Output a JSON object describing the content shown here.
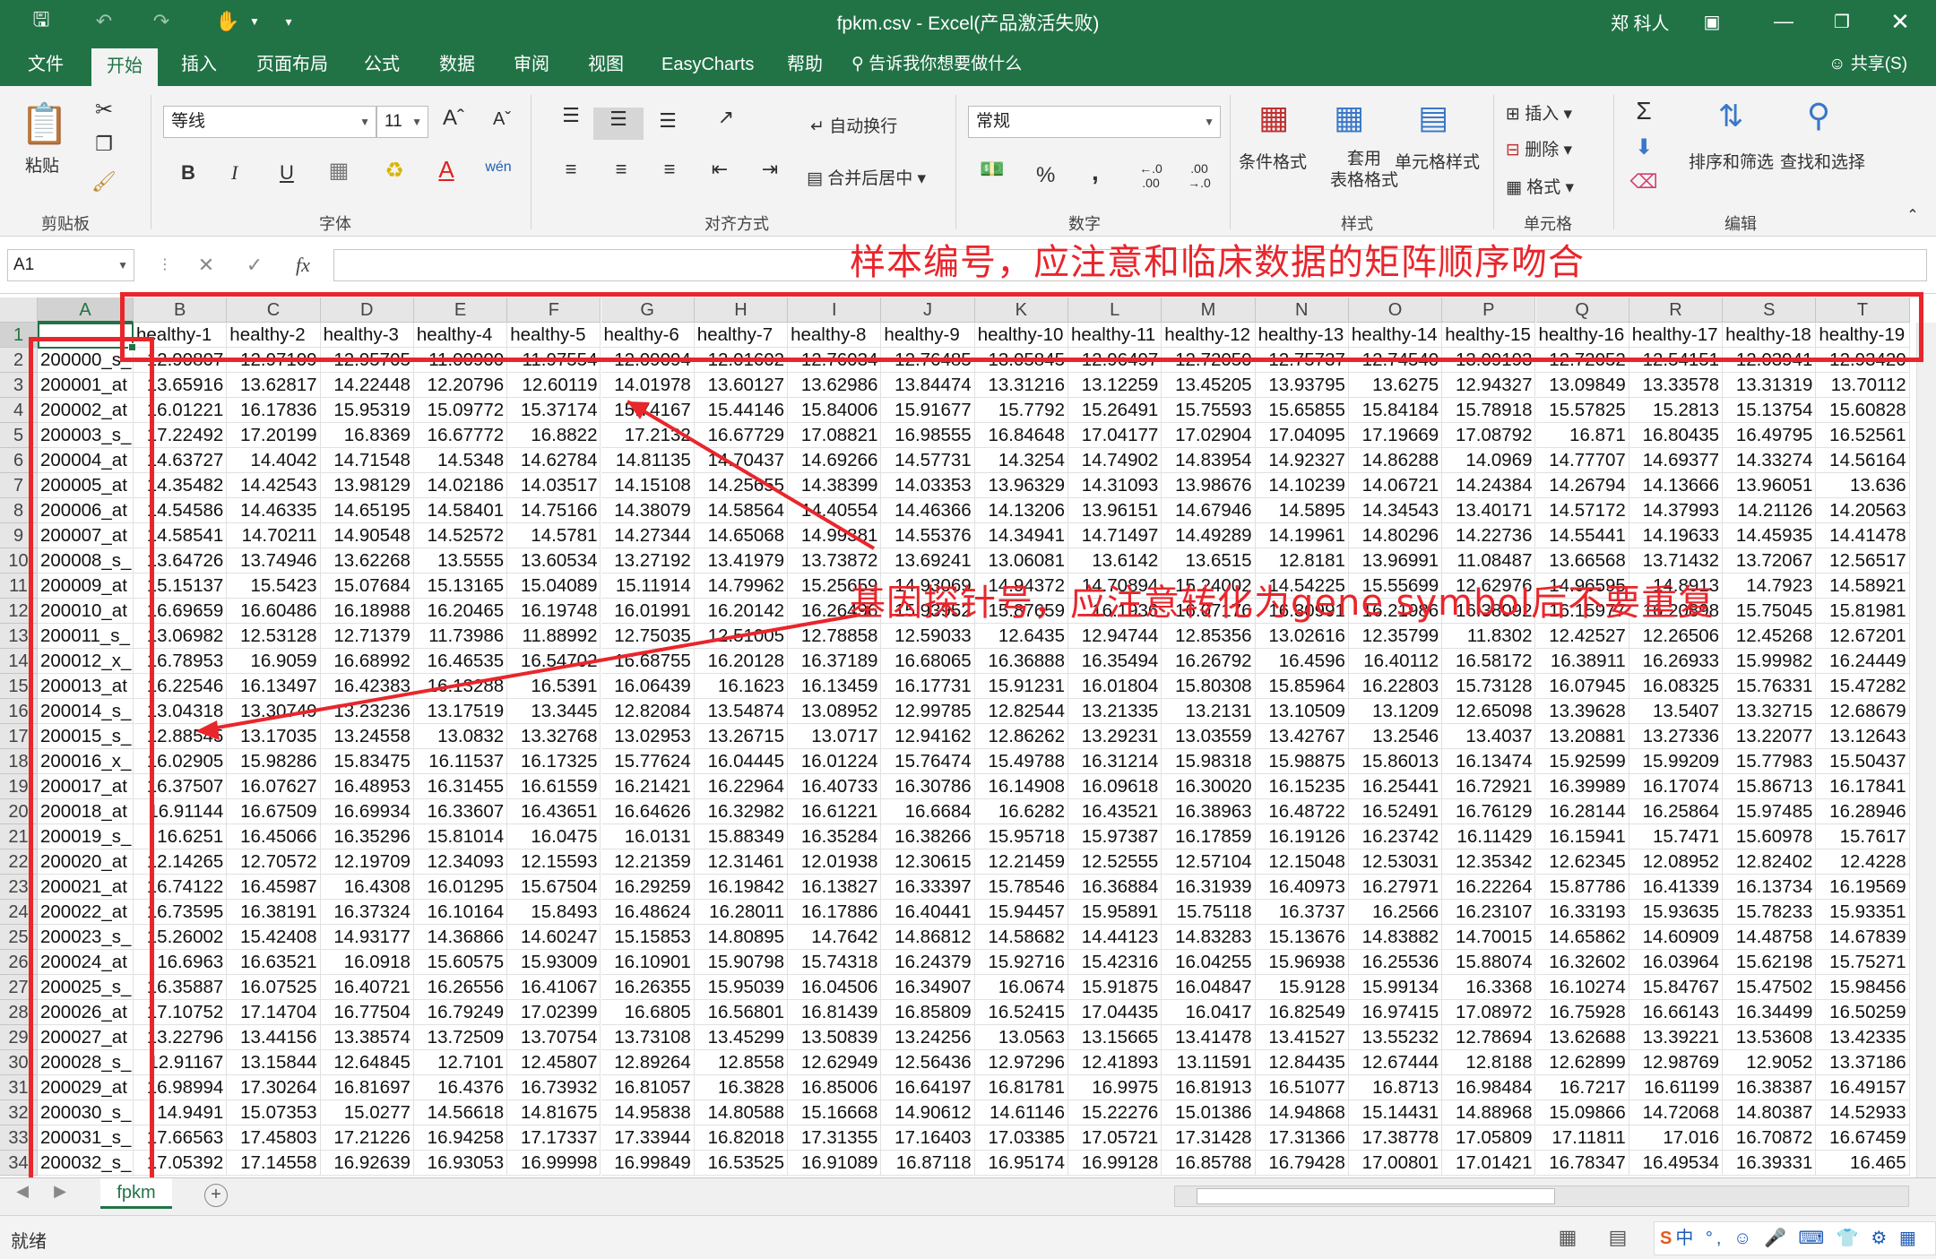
{
  "window": {
    "title": "fpkm.csv  -  Excel(产品激活失败)",
    "user": "郑 科人",
    "qat": [
      "save-icon",
      "undo-icon",
      "redo-icon",
      "touch-icon",
      "customize-icon"
    ]
  },
  "tabs": [
    {
      "label": "文件"
    },
    {
      "label": "开始"
    },
    {
      "label": "插入"
    },
    {
      "label": "页面布局"
    },
    {
      "label": "公式"
    },
    {
      "label": "数据"
    },
    {
      "label": "审阅"
    },
    {
      "label": "视图"
    },
    {
      "label": "EasyCharts"
    },
    {
      "label": "帮助"
    }
  ],
  "tell_me": "告诉我你想要做什么",
  "share_label": "共享(S)",
  "ribbon": {
    "clipboard": {
      "label": "剪贴板",
      "paste": "粘贴"
    },
    "font": {
      "label": "字体",
      "name": "等线",
      "size": "11",
      "bold": "B",
      "italic": "I",
      "underline": "U"
    },
    "alignment": {
      "label": "对齐方式",
      "wrap": "自动换行",
      "merge": "合并后居中"
    },
    "number": {
      "label": "数字",
      "format": "常规",
      "percent": "%",
      "comma": ","
    },
    "styles": {
      "label": "样式",
      "conditional": "条件格式",
      "table": "套用\n表格格式",
      "cell": "单元格样式"
    },
    "cells": {
      "label": "单元格",
      "insert": "插入",
      "delete": "删除",
      "format": "格式"
    },
    "editing": {
      "label": "编辑",
      "sort": "排序和筛选",
      "find": "查找和选择"
    }
  },
  "formula_bar": {
    "name_box": "A1",
    "fx": "fx",
    "value": ""
  },
  "columns": [
    "A",
    "B",
    "C",
    "D",
    "E",
    "F",
    "G",
    "H",
    "I",
    "J",
    "K",
    "L",
    "M",
    "N",
    "O",
    "P",
    "Q",
    "R",
    "S",
    "T"
  ],
  "selected_cell": "A1",
  "header_row": [
    "",
    "healthy-1",
    "healthy-2",
    "healthy-3",
    "healthy-4",
    "healthy-5",
    "healthy-6",
    "healthy-7",
    "healthy-8",
    "healthy-9",
    "healthy-10",
    "healthy-11",
    "healthy-12",
    "healthy-13",
    "healthy-14",
    "healthy-15",
    "healthy-16",
    "healthy-17",
    "healthy-18",
    "healthy-19"
  ],
  "rows": [
    [
      "200000_s_",
      "12.90807",
      "12.97109",
      "12.95705",
      "11.00900",
      "11.97554",
      "12.09094",
      "12.01602",
      "12.76034",
      "12.76485",
      "13.05845",
      "12.96497",
      "12.72050",
      "12.75737",
      "12.74540",
      "13.09193",
      "12.72052",
      "12.54151",
      "12.03941",
      "12.93420"
    ],
    [
      "200001_at",
      "13.65916",
      "13.62817",
      "14.22448",
      "12.20796",
      "12.60119",
      "14.01978",
      "13.60127",
      "13.62986",
      "13.84474",
      "13.31216",
      "13.12259",
      "13.45205",
      "13.93795",
      "13.6275",
      "12.94327",
      "13.09849",
      "13.33578",
      "13.31319",
      "13.70112"
    ],
    [
      "200002_at",
      "16.01221",
      "16.17836",
      "15.95319",
      "15.09772",
      "15.37174",
      "15.74167",
      "15.44146",
      "15.84006",
      "15.91677",
      "15.7792",
      "15.26491",
      "15.75593",
      "15.65855",
      "15.84184",
      "15.78918",
      "15.57825",
      "15.2813",
      "15.13754",
      "15.60828"
    ],
    [
      "200003_s_",
      "17.22492",
      "17.20199",
      "16.8369",
      "16.67772",
      "16.8822",
      "17.2132",
      "16.67729",
      "17.08821",
      "16.98555",
      "16.84648",
      "17.04177",
      "17.02904",
      "17.04095",
      "17.19669",
      "17.08792",
      "16.871",
      "16.80435",
      "16.49795",
      "16.52561"
    ],
    [
      "200004_at",
      "14.63727",
      "14.4042",
      "14.71548",
      "14.5348",
      "14.62784",
      "14.81135",
      "14.70437",
      "14.69266",
      "14.57731",
      "14.3254",
      "14.74902",
      "14.83954",
      "14.92327",
      "14.86288",
      "14.0969",
      "14.77707",
      "14.69377",
      "14.33274",
      "14.56164"
    ],
    [
      "200005_at",
      "14.35482",
      "14.42543",
      "13.98129",
      "14.02186",
      "14.03517",
      "14.15108",
      "14.25655",
      "14.38399",
      "14.03353",
      "13.96329",
      "14.31093",
      "13.98676",
      "14.10239",
      "14.06721",
      "14.24384",
      "14.26794",
      "14.13666",
      "13.96051",
      "13.636"
    ],
    [
      "200006_at",
      "14.54586",
      "14.46335",
      "14.65195",
      "14.58401",
      "14.75166",
      "14.38079",
      "14.58564",
      "14.40554",
      "14.46366",
      "14.13206",
      "13.96151",
      "14.67946",
      "14.5895",
      "14.34543",
      "13.40171",
      "14.57172",
      "14.37993",
      "14.21126",
      "14.20563"
    ],
    [
      "200007_at",
      "14.58541",
      "14.70211",
      "14.90548",
      "14.52572",
      "14.5781",
      "14.27344",
      "14.65068",
      "14.99381",
      "14.55376",
      "14.34941",
      "14.71497",
      "14.49289",
      "14.19961",
      "14.80296",
      "14.22736",
      "14.55441",
      "14.19633",
      "14.45935",
      "14.41478"
    ],
    [
      "200008_s_",
      "13.64726",
      "13.74946",
      "13.62268",
      "13.5555",
      "13.60534",
      "13.27192",
      "13.41979",
      "13.73872",
      "13.69241",
      "13.06081",
      "13.6142",
      "13.6515",
      "12.8181",
      "13.96991",
      "11.08487",
      "13.66568",
      "13.71432",
      "13.72067",
      "12.56517"
    ],
    [
      "200009_at",
      "15.15137",
      "15.5423",
      "15.07684",
      "15.13165",
      "15.04089",
      "15.11914",
      "14.79962",
      "15.25659",
      "14.93069",
      "14.94372",
      "14.70894",
      "15.24002",
      "14.54225",
      "15.55699",
      "12.62976",
      "14.96595",
      "14.8913",
      "14.7923",
      "14.58921"
    ],
    [
      "200010_at",
      "16.69659",
      "16.60486",
      "16.18988",
      "16.20465",
      "16.19748",
      "16.01991",
      "16.20142",
      "16.26496",
      "15.93952",
      "15.87659",
      "16.1936",
      "16.07176",
      "16.30991",
      "16.21986",
      "16.38092",
      "16.15977",
      "16.20898",
      "15.75045",
      "15.81981"
    ],
    [
      "200011_s_",
      "13.06982",
      "12.53128",
      "12.71379",
      "11.73986",
      "11.88992",
      "12.75035",
      "12.51005",
      "12.78858",
      "12.59033",
      "12.6435",
      "12.94744",
      "12.85356",
      "13.02616",
      "12.35799",
      "11.8302",
      "12.42527",
      "12.26506",
      "12.45268",
      "12.67201"
    ],
    [
      "200012_x_",
      "16.78953",
      "16.9059",
      "16.68992",
      "16.46535",
      "16.54702",
      "16.68755",
      "16.20128",
      "16.37189",
      "16.68065",
      "16.36888",
      "16.35494",
      "16.26792",
      "16.4596",
      "16.40112",
      "16.58172",
      "16.38911",
      "16.26933",
      "15.99982",
      "16.24449"
    ],
    [
      "200013_at",
      "16.22546",
      "16.13497",
      "16.42383",
      "16.13288",
      "16.5391",
      "16.06439",
      "16.1623",
      "16.13459",
      "16.17731",
      "15.91231",
      "16.01804",
      "15.80308",
      "15.85964",
      "16.22803",
      "15.73128",
      "16.07945",
      "16.08325",
      "15.76331",
      "15.47282"
    ],
    [
      "200014_s_",
      "13.04318",
      "13.30749",
      "13.23236",
      "13.17519",
      "13.3445",
      "12.82084",
      "13.54874",
      "13.08952",
      "12.99785",
      "12.82544",
      "13.21335",
      "13.2131",
      "13.10509",
      "13.1209",
      "12.65098",
      "13.39628",
      "13.5407",
      "13.32715",
      "12.68679"
    ],
    [
      "200015_s_",
      "12.88545",
      "13.17035",
      "13.24558",
      "13.0832",
      "13.32768",
      "13.02953",
      "13.26715",
      "13.0717",
      "12.94162",
      "12.86262",
      "13.29231",
      "13.03559",
      "13.42767",
      "13.2546",
      "13.4037",
      "13.20881",
      "13.27336",
      "13.22077",
      "13.12643"
    ],
    [
      "200016_x_",
      "16.02905",
      "15.98286",
      "15.83475",
      "16.11537",
      "16.17325",
      "15.77624",
      "16.04445",
      "16.01224",
      "15.76474",
      "15.49788",
      "16.31214",
      "15.98318",
      "15.98875",
      "15.86013",
      "16.13474",
      "15.92599",
      "15.99209",
      "15.77983",
      "15.50437"
    ],
    [
      "200017_at",
      "16.37507",
      "16.07627",
      "16.48953",
      "16.31455",
      "16.61559",
      "16.21421",
      "16.22964",
      "16.40733",
      "16.30786",
      "16.14908",
      "16.09618",
      "16.30020",
      "16.15235",
      "16.25441",
      "16.72921",
      "16.39989",
      "16.17074",
      "15.86713",
      "16.17841"
    ],
    [
      "200018_at",
      "16.91144",
      "16.67509",
      "16.69934",
      "16.33607",
      "16.43651",
      "16.64626",
      "16.32982",
      "16.61221",
      "16.6684",
      "16.6282",
      "16.43521",
      "16.38963",
      "16.48722",
      "16.52491",
      "16.76129",
      "16.28144",
      "16.25864",
      "15.97485",
      "16.28946"
    ],
    [
      "200019_s_",
      "16.6251",
      "16.45066",
      "16.35296",
      "15.81014",
      "16.0475",
      "16.0131",
      "15.88349",
      "16.35284",
      "16.38266",
      "15.95718",
      "15.97387",
      "16.17859",
      "16.19126",
      "16.23742",
      "16.11429",
      "16.15941",
      "15.7471",
      "15.60978",
      "15.7617"
    ],
    [
      "200020_at",
      "12.14265",
      "12.70572",
      "12.19709",
      "12.34093",
      "12.15593",
      "12.21359",
      "12.31461",
      "12.01938",
      "12.30615",
      "12.21459",
      "12.52555",
      "12.57104",
      "12.15048",
      "12.53031",
      "12.35342",
      "12.62345",
      "12.08952",
      "12.82402",
      "12.4228"
    ],
    [
      "200021_at",
      "16.74122",
      "16.45987",
      "16.4308",
      "16.01295",
      "15.67504",
      "16.29259",
      "16.19842",
      "16.13827",
      "16.33397",
      "15.78546",
      "16.36884",
      "16.31939",
      "16.40973",
      "16.27971",
      "16.22264",
      "15.87786",
      "16.41339",
      "16.13734",
      "16.19569"
    ],
    [
      "200022_at",
      "16.73595",
      "16.38191",
      "16.37324",
      "16.10164",
      "15.8493",
      "16.48624",
      "16.28011",
      "16.17886",
      "16.40441",
      "15.94457",
      "15.95891",
      "15.75118",
      "16.3737",
      "16.2566",
      "16.23107",
      "16.33193",
      "15.93635",
      "15.78233",
      "15.93351"
    ],
    [
      "200023_s_",
      "15.26002",
      "15.42408",
      "14.93177",
      "14.36866",
      "14.60247",
      "15.15853",
      "14.80895",
      "14.7642",
      "14.86812",
      "14.58682",
      "14.44123",
      "14.83283",
      "15.13676",
      "14.83882",
      "14.70015",
      "14.65862",
      "14.60909",
      "14.48758",
      "14.67839"
    ],
    [
      "200024_at",
      "16.6963",
      "16.63521",
      "16.0918",
      "15.60575",
      "15.93009",
      "16.10901",
      "15.90798",
      "15.74318",
      "16.24379",
      "15.92716",
      "15.42316",
      "16.04255",
      "15.96938",
      "16.25536",
      "15.88074",
      "16.32602",
      "16.03964",
      "15.62198",
      "15.75271"
    ],
    [
      "200025_s_",
      "16.35887",
      "16.07525",
      "16.40721",
      "16.26556",
      "16.41067",
      "16.26355",
      "15.95039",
      "16.04506",
      "16.34907",
      "16.0674",
      "15.91875",
      "16.04847",
      "15.9128",
      "15.99134",
      "16.3368",
      "16.10274",
      "15.84767",
      "15.47502",
      "15.98456"
    ],
    [
      "200026_at",
      "17.10752",
      "17.14704",
      "16.77504",
      "16.79249",
      "17.02399",
      "16.6805",
      "16.56801",
      "16.81439",
      "16.85809",
      "16.52415",
      "17.04435",
      "16.0417",
      "16.82549",
      "16.97415",
      "17.08972",
      "16.75928",
      "16.66143",
      "16.34499",
      "16.50259"
    ],
    [
      "200027_at",
      "13.22796",
      "13.44156",
      "13.38574",
      "13.72509",
      "13.70754",
      "13.73108",
      "13.45299",
      "13.50839",
      "13.24256",
      "13.0563",
      "13.15665",
      "13.41478",
      "13.41527",
      "13.55232",
      "12.78694",
      "13.62688",
      "13.39221",
      "13.53608",
      "13.42335"
    ],
    [
      "200028_s_",
      "12.91167",
      "13.15844",
      "12.64845",
      "12.7101",
      "12.45807",
      "12.89264",
      "12.8558",
      "12.62949",
      "12.56436",
      "12.97296",
      "12.41893",
      "13.11591",
      "12.84435",
      "12.67444",
      "12.8188",
      "12.62899",
      "12.98769",
      "12.9052",
      "13.37186"
    ],
    [
      "200029_at",
      "16.98994",
      "17.30264",
      "16.81697",
      "16.4376",
      "16.73932",
      "16.81057",
      "16.3828",
      "16.85006",
      "16.64197",
      "16.81781",
      "16.9975",
      "16.81913",
      "16.51077",
      "16.8713",
      "16.98484",
      "16.7217",
      "16.61199",
      "16.38387",
      "16.49157"
    ],
    [
      "200030_s_",
      "14.9491",
      "15.07353",
      "15.0277",
      "14.56618",
      "14.81675",
      "14.95838",
      "14.80588",
      "15.16668",
      "14.90612",
      "14.61146",
      "15.22276",
      "15.01386",
      "14.94868",
      "15.14431",
      "14.88968",
      "15.09866",
      "14.72068",
      "14.80387",
      "14.52933"
    ],
    [
      "200031_s_",
      "17.66563",
      "17.45803",
      "17.21226",
      "16.94258",
      "17.17337",
      "17.33944",
      "16.82018",
      "17.31355",
      "17.16403",
      "17.03385",
      "17.05721",
      "17.31428",
      "17.31366",
      "17.38778",
      "17.05809",
      "17.11811",
      "17.016",
      "16.70872",
      "16.67459"
    ],
    [
      "200032_s_",
      "17.05392",
      "17.14558",
      "16.92639",
      "16.93053",
      "16.99998",
      "16.99849",
      "16.53525",
      "16.91089",
      "16.87118",
      "16.95174",
      "16.99128",
      "16.85788",
      "16.79428",
      "17.00801",
      "17.01421",
      "16.78347",
      "16.49534",
      "16.39331",
      "16.465"
    ]
  ],
  "annotations": {
    "top": "样本编号，应注意和临床数据的矩阵顺序吻合",
    "bottom": "基因探针号，应注意转化为gene symbol后不要重复"
  },
  "sheet_tab": "fpkm",
  "status": "就绪",
  "colors": {
    "accent": "#217346",
    "annotation": "#e8262c"
  }
}
